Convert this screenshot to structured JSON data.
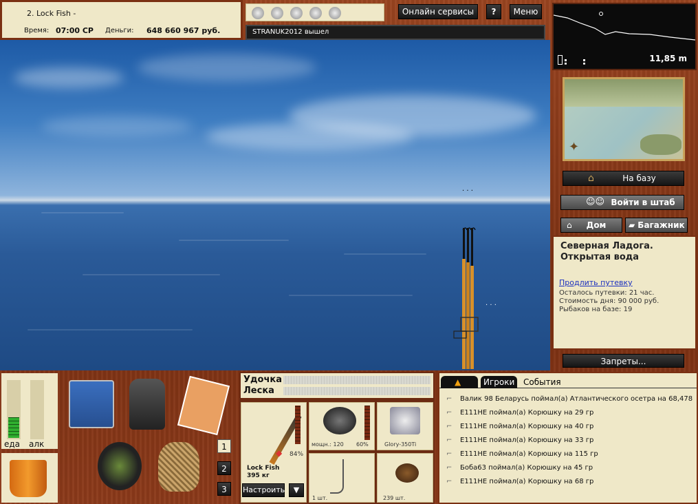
{
  "top": {
    "player": "2. Lock Fish -",
    "time_label": "Время:",
    "time_value": "07:00 СР",
    "money_label": "Деньги:",
    "money_value": "648 660 967 руб."
  },
  "header": {
    "online_services": "Онлайн сервисы",
    "help": "?",
    "menu": "Меню",
    "message": "STRANUK2012 вышел"
  },
  "depth": {
    "value": "11,85 m"
  },
  "right": {
    "to_base": "На базу",
    "join_hq": "Войти в штаб",
    "home": "Дом",
    "trunk": "Багажник",
    "bans": "Запреты..."
  },
  "location": {
    "title": "Северная Ладога. Открытая вода",
    "extend_link": "Продлить путевку",
    "remaining": "Осталось путевки: 21 час.",
    "day_cost": "Стоимость дня: 90 000 руб.",
    "anglers": "Рыбаков на базе: 19"
  },
  "status": {
    "food": "еда",
    "alcohol": "алк",
    "food_level": 0.35,
    "alcohol_level": 0
  },
  "inventory": {
    "slots": [
      "1",
      "2",
      "3"
    ]
  },
  "tackle": {
    "rod_label": "Удочка",
    "line_label": "Леска",
    "rod_name": "Lock Fish",
    "rod_weight": "395 кг",
    "rod_percent": "84%",
    "reel_power": "мощн.: 120",
    "reel_percent": "60%",
    "line_name": "Glory-350Ti",
    "float_count": "1 шт.",
    "bait_count": "239 шт.",
    "configure": "Настроить",
    "arrow": "▼"
  },
  "feed": {
    "tabs": [
      "Игроки",
      "События"
    ],
    "events": [
      "Валик 98 Беларусь поймал(а) Атлантического осетра на 68,478",
      "E111HE поймал(а) Корюшку на 29 гр",
      "E111HE поймал(а) Корюшку на 40 гр",
      "E111HE поймал(а) Корюшку на 33 гр",
      "E111HE поймал(а) Корюшку на 115 гр",
      "Боба63 поймал(а) Корюшку на 45 гр",
      "E111HE поймал(а) Корюшку на 68 гр"
    ]
  },
  "colors": {
    "accent": "#7a3012",
    "paper": "#efe8c8",
    "link": "#1a2fbf",
    "meter_green": "#2fae2f"
  }
}
